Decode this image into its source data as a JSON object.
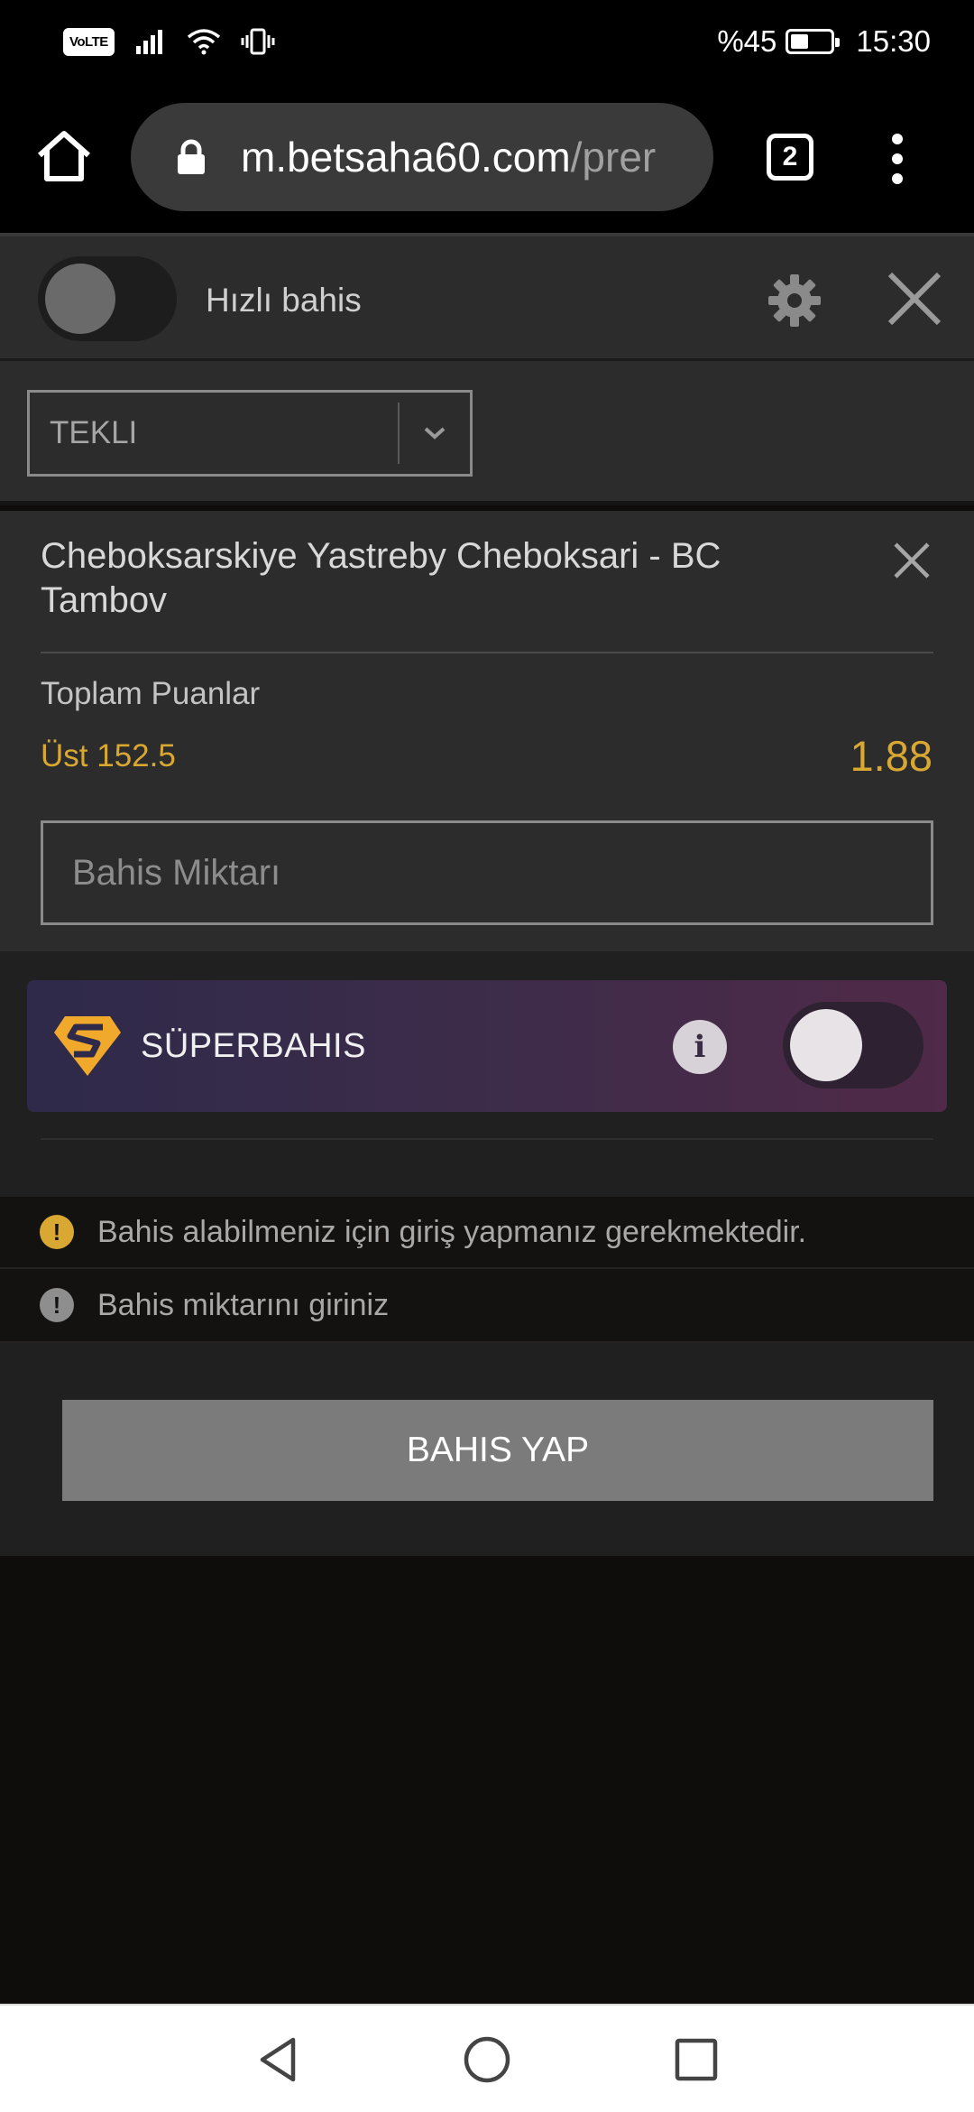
{
  "status_bar": {
    "volte_label": "VoLTE",
    "battery_text": "%45",
    "battery_level_percent": 45,
    "time": "15:30",
    "icons": [
      "signal-icon",
      "wifi-icon",
      "vibrate-icon",
      "battery-icon"
    ]
  },
  "browser": {
    "url_host": "m.betsaha60.com",
    "url_path": "/prer",
    "tab_count": "2",
    "icons": [
      "home-icon",
      "lock-icon",
      "tabs-icon",
      "overflow-menu-icon"
    ]
  },
  "slip_header": {
    "quick_bet_label": "Hızlı bahis",
    "quick_bet_enabled": false,
    "icons": [
      "gear-icon",
      "close-icon"
    ]
  },
  "bet_type": {
    "selected": "TEKLI"
  },
  "selection": {
    "match": "Cheboksarskiye Yastreby Cheboksari - BC Tambov",
    "market": "Toplam Puanlar",
    "pick": "Üst 152.5",
    "odds": "1.88",
    "stake_placeholder": "Bahis Miktarı",
    "stake_value": ""
  },
  "superbahis": {
    "label": "SÜPERBAHIS",
    "info_glyph": "i",
    "enabled": false
  },
  "messages": [
    {
      "type": "warning",
      "glyph": "!",
      "text": "Bahis alabilmeniz için giriş yapmanız gerekmektedir."
    },
    {
      "type": "error",
      "glyph": "!",
      "text": "Bahis miktarını giriniz"
    }
  ],
  "actions": {
    "place_bet_label": "BAHIS YAP"
  },
  "colors": {
    "accent_gold": "#d9a832",
    "panel_bg": "#2c2c2c",
    "button_gray": "#7b7b7b",
    "super_gradient_start": "#2f2a4a",
    "super_gradient_end": "#502a48"
  },
  "nav_bar": {
    "icons": [
      "back-icon",
      "home-circle-icon",
      "recent-apps-icon"
    ]
  }
}
